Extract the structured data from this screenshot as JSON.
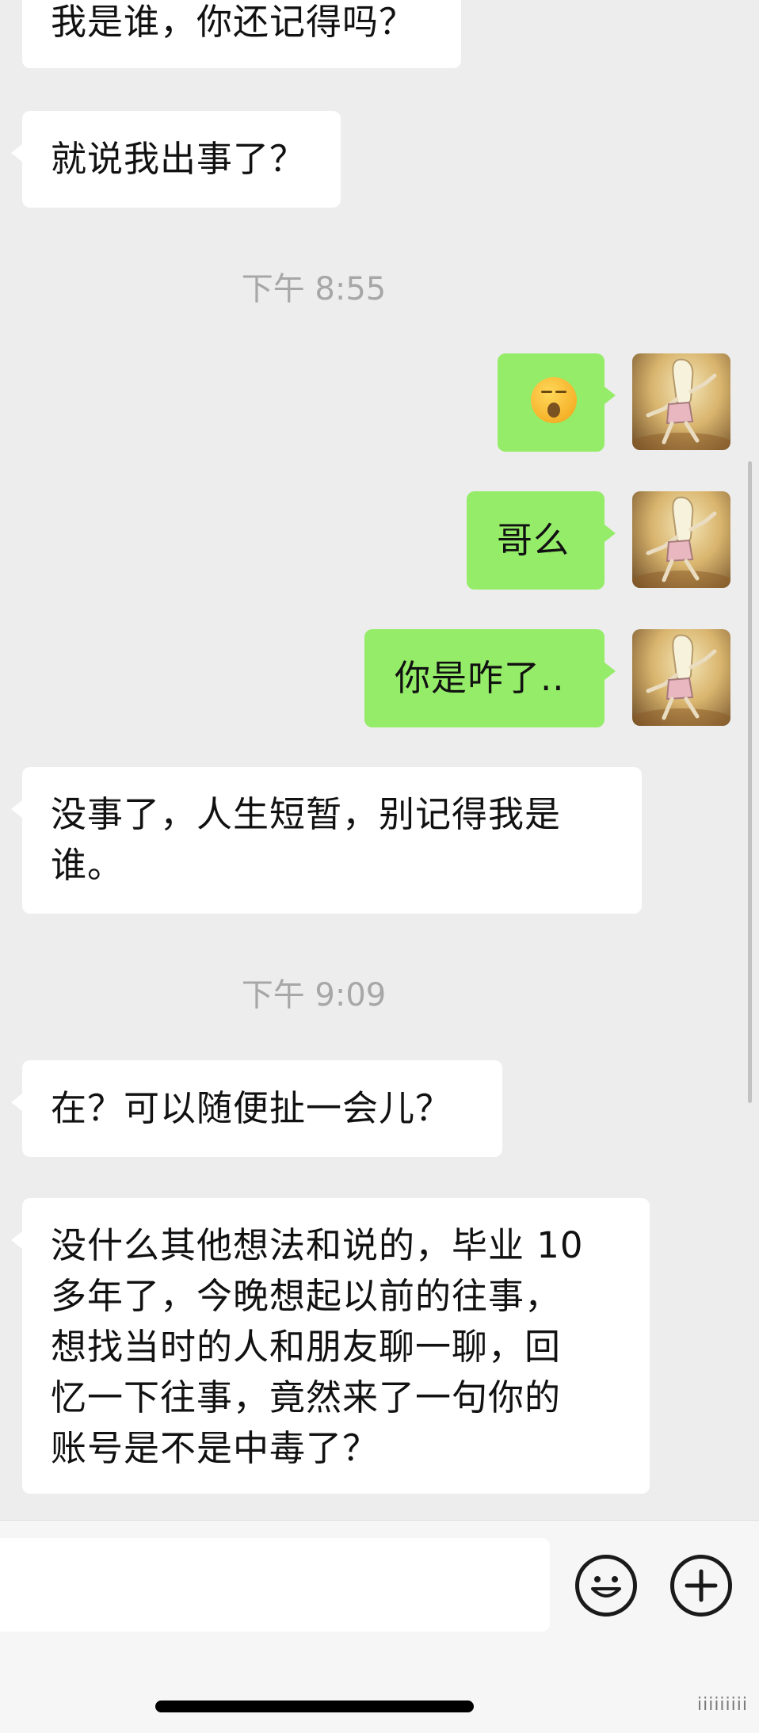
{
  "messages": {
    "m1": "我是谁，你还记得吗？",
    "m2": "就说我出事了？",
    "ts1": "下午 8:55",
    "m3_emoji": "face-with-open-mouth-emoji",
    "m4": "哥么",
    "m5": "你是咋了..",
    "m6_line1": "没事了，人生短暂，别记得我是",
    "m6_line2": "谁。",
    "ts2": "下午 9:09",
    "m7": "在？可以随便扯一会儿？",
    "m8_line1": "没什么其他想法和说的，毕业 10",
    "m8_line2": "多年了，今晚想起以前的往事，",
    "m8_line3": "想找当时的人和朋友聊一聊，回",
    "m8_line4": "忆一下往事，竟然来了一句你的",
    "m8_line5": "账号是不是中毒了？"
  },
  "input": {
    "placeholder": "",
    "emoji_button_icon": "smiley-icon",
    "more_button_icon": "plus-icon"
  },
  "watermark": "iiiiiiiii",
  "colors": {
    "background": "#ededed",
    "incoming_bubble": "#ffffff",
    "outgoing_bubble": "#95ec69",
    "timestamp": "#a7a7a7"
  }
}
